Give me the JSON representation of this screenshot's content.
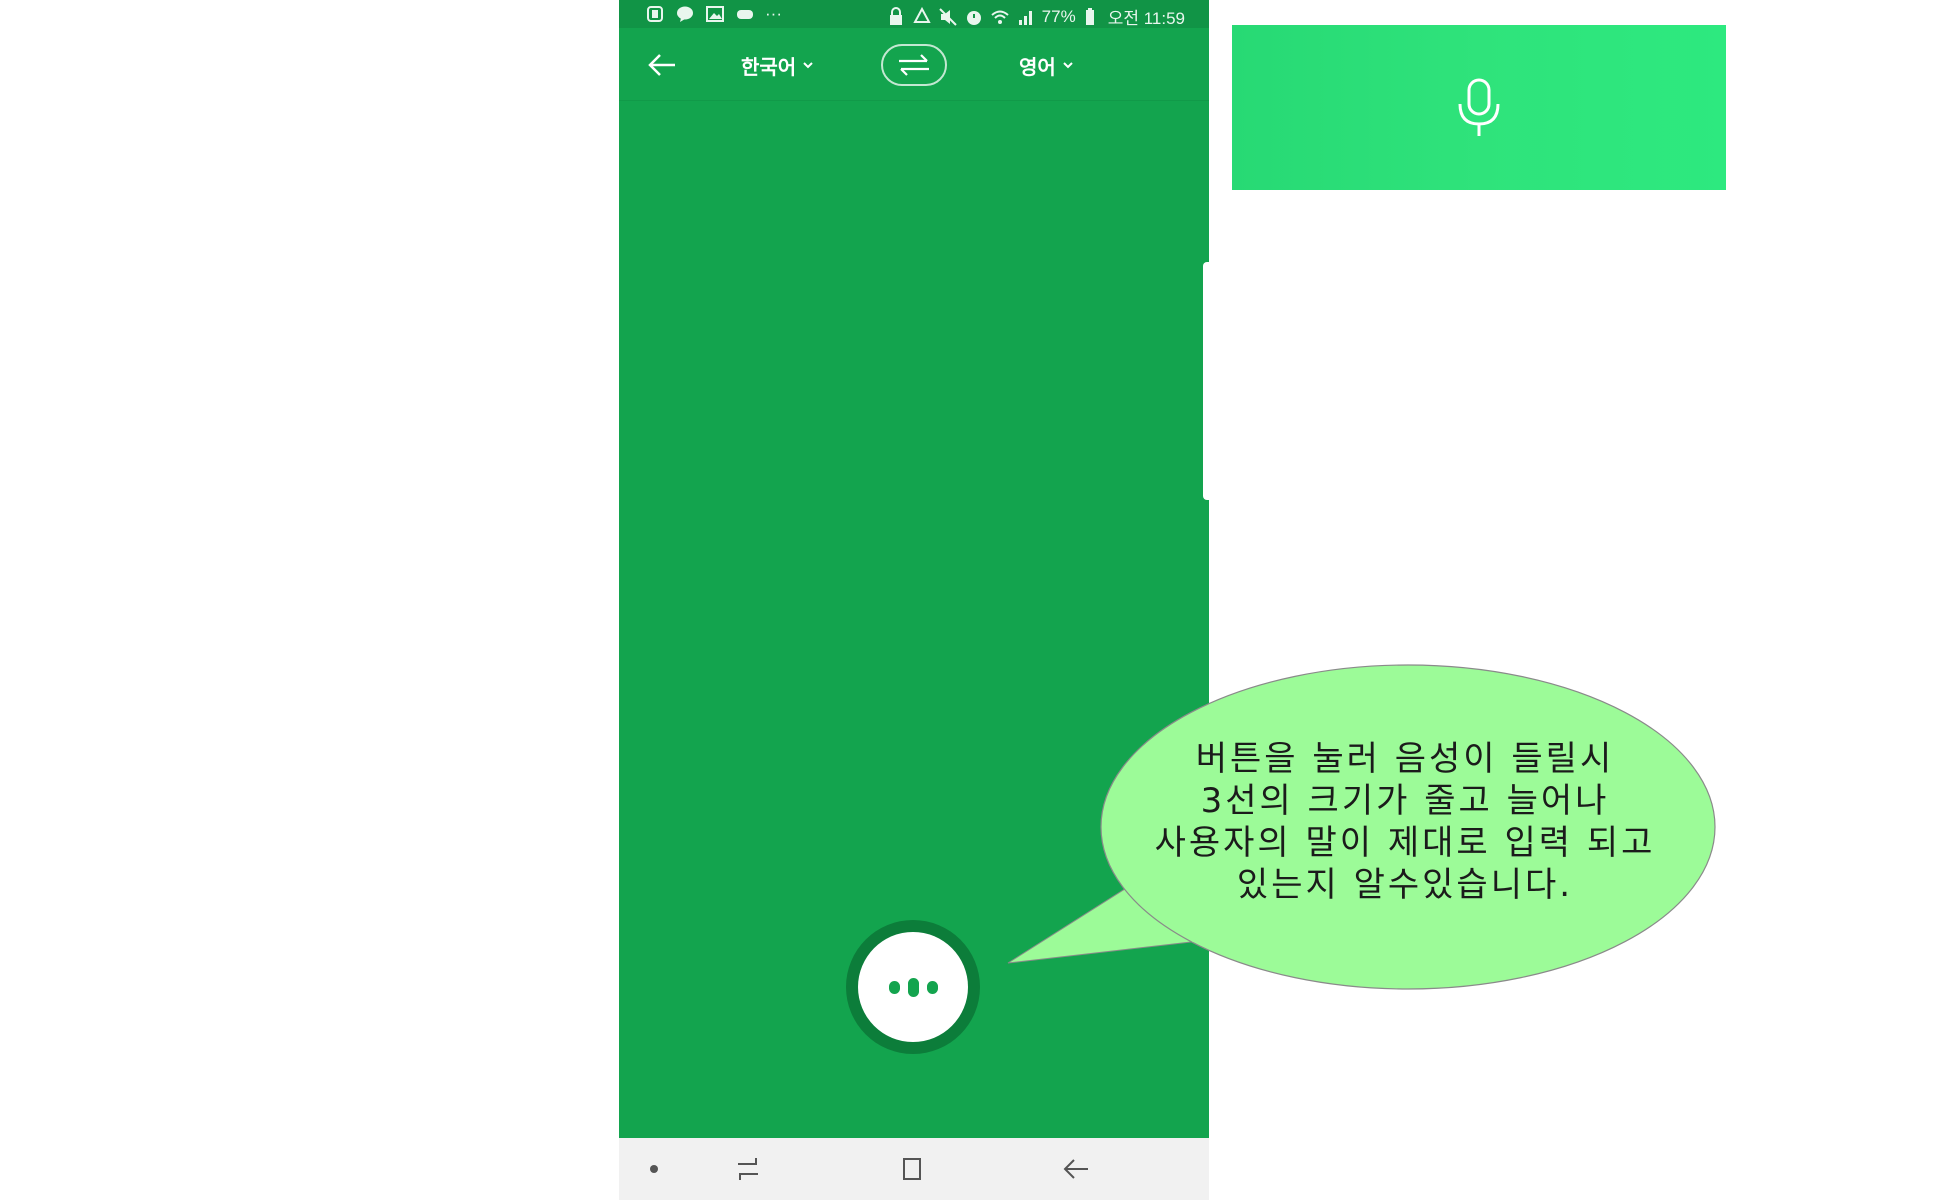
{
  "status_bar": {
    "battery": "77%",
    "time": "오전 11:59",
    "overflow": "···",
    "left_icons": [
      "office-icon",
      "chat-icon",
      "gallery-icon",
      "game-icon"
    ],
    "right_icons": [
      "lock-icon",
      "recycle-icon",
      "mute-icon",
      "alarm-icon",
      "wifi-icon",
      "signal-icon",
      "battery-icon"
    ]
  },
  "app_bar": {
    "source_language": "한국어",
    "target_language": "영어"
  },
  "voice_input": {
    "state": "listening",
    "icon": "dots-waveform-icon"
  },
  "nav_bar": {
    "items": [
      "dot-icon",
      "recent-apps-icon",
      "home-icon",
      "back-icon"
    ]
  },
  "banner": {
    "icon": "microphone-icon"
  },
  "callout": {
    "lines": [
      "버튼을 눌러 음성이 들릴시",
      "3선의 크기가 줄고 늘어나",
      "사용자의 말이 제대로 입력 되고",
      "있는지 알수있습니다."
    ]
  },
  "colors": {
    "app_green": "#13a44e",
    "status_green": "#119446",
    "banner_green": "#2de97f",
    "bubble_fill": "#9cfb98"
  }
}
